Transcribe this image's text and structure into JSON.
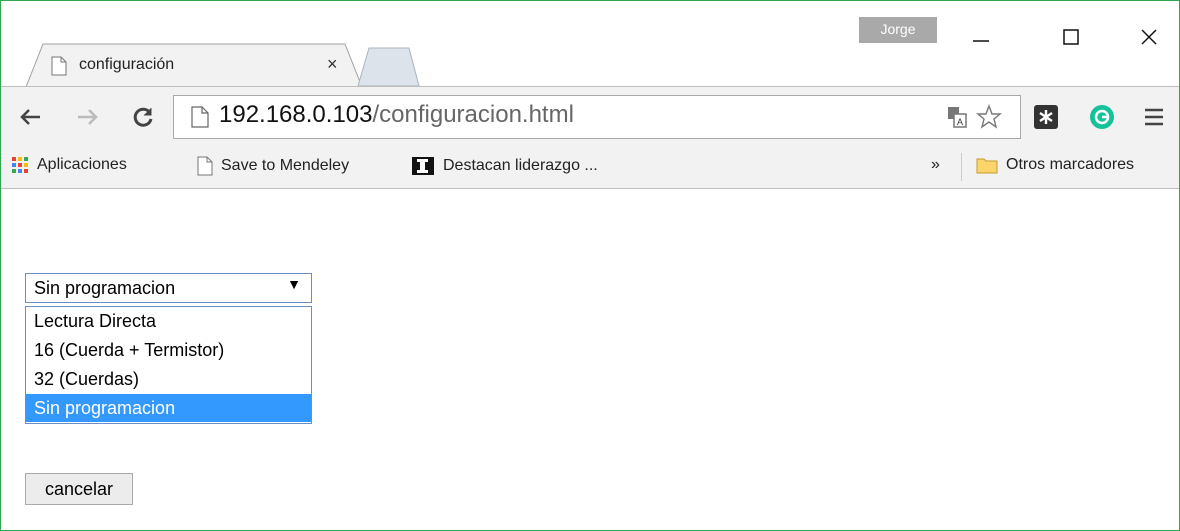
{
  "window": {
    "profile_name": "Jorge"
  },
  "tab": {
    "title": "configuración",
    "close_symbol": "×"
  },
  "address_bar": {
    "host": "192.168.0.103",
    "path": "/configuracion.html"
  },
  "bookmarks": {
    "items": [
      {
        "label": "Aplicaciones",
        "icon": "apps-grid-icon"
      },
      {
        "label": "Save to Mendeley",
        "icon": "page-icon"
      },
      {
        "label": "Destacan liderazgo ...",
        "icon": "bookmark-favicon-icon"
      }
    ],
    "overflow": "»",
    "other_label": "Otros marcadores"
  },
  "form": {
    "select": {
      "selected": "Sin programacion",
      "arrow": "▼",
      "options": [
        "Lectura Directa",
        "16 (Cuerda + Termistor)",
        "32 (Cuerdas)",
        "Sin programacion"
      ]
    },
    "cancel_label": "cancelar"
  },
  "colors": {
    "window_border": "#2fa84f",
    "highlight": "#3399ff",
    "profile_bg": "#a9a9a9"
  }
}
